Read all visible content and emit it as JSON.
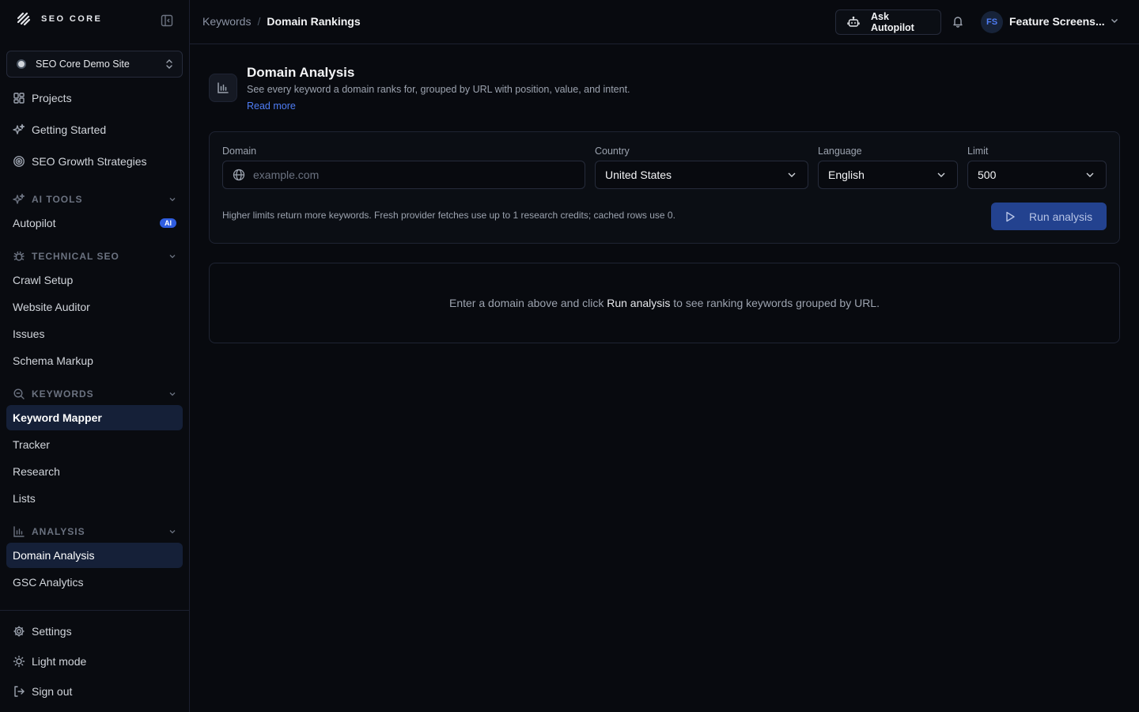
{
  "brand": {
    "name": "SEO CORE"
  },
  "site_selector": {
    "label": "SEO Core Demo Site"
  },
  "sidebar": {
    "top_items": [
      {
        "label": "Projects",
        "icon": "grid-icon"
      },
      {
        "label": "Getting Started",
        "icon": "sparkles-icon"
      },
      {
        "label": "SEO Growth Strategies",
        "icon": "target-icon"
      }
    ],
    "sections": {
      "ai_tools": {
        "title": "AI TOOLS",
        "items": [
          {
            "label": "Autopilot",
            "badge": "AI"
          }
        ]
      },
      "technical_seo": {
        "title": "TECHNICAL SEO",
        "items": [
          {
            "label": "Crawl Setup"
          },
          {
            "label": "Website Auditor"
          },
          {
            "label": "Issues"
          },
          {
            "label": "Schema Markup"
          }
        ]
      },
      "keywords": {
        "title": "KEYWORDS",
        "items": [
          {
            "label": "Keyword Mapper"
          },
          {
            "label": "Tracker"
          },
          {
            "label": "Research"
          },
          {
            "label": "Lists"
          }
        ]
      },
      "analysis": {
        "title": "ANALYSIS",
        "items": [
          {
            "label": "Domain Analysis"
          },
          {
            "label": "GSC Analytics"
          }
        ]
      }
    },
    "bottom_items": [
      {
        "label": "Settings",
        "icon": "gear-icon"
      },
      {
        "label": "Light mode",
        "icon": "sun-icon"
      },
      {
        "label": "Sign out",
        "icon": "sign-out-icon"
      }
    ]
  },
  "header": {
    "breadcrumb_parent": "Keywords",
    "breadcrumb_separator": "/",
    "breadcrumb_current": "Domain Rankings",
    "ask_button": "Ask Autopilot",
    "user_initials": "FS",
    "user_name": "Feature Screens..."
  },
  "page": {
    "title": "Domain Analysis",
    "description": "See every keyword a domain ranks for, grouped by URL with position, value, and intent.",
    "read_more": "Read more"
  },
  "form": {
    "domain": {
      "label": "Domain",
      "placeholder": "example.com",
      "value": ""
    },
    "country": {
      "label": "Country",
      "value": "United States"
    },
    "language": {
      "label": "Language",
      "value": "English"
    },
    "limit": {
      "label": "Limit",
      "value": "500"
    },
    "hint": "Higher limits return more keywords. Fresh provider fetches use up to 1 research credits; cached rows use 0.",
    "run_button": "Run analysis"
  },
  "empty_state": {
    "prefix": "Enter a domain above and click ",
    "highlight": "Run analysis",
    "suffix": " to see ranking keywords grouped by URL."
  },
  "colors": {
    "background": "#080a0f",
    "accent": "#4f7df5",
    "active_nav": "#152038",
    "run_button": "#23428f"
  }
}
